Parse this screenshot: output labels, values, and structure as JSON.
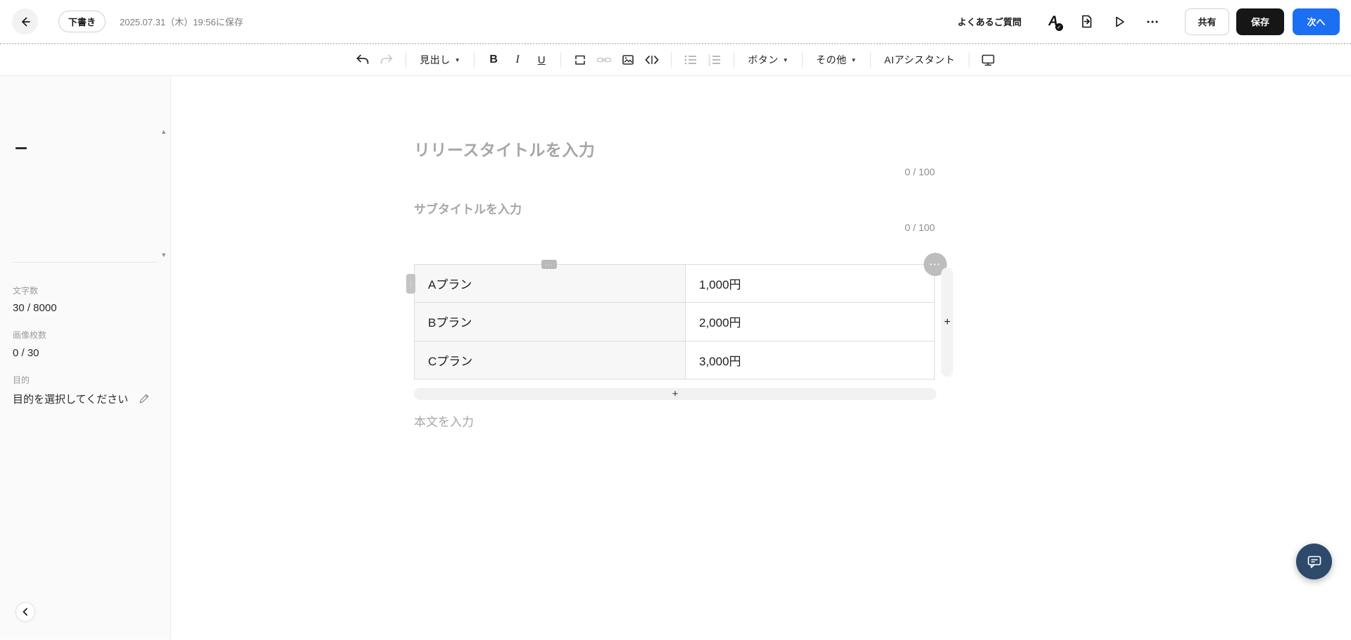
{
  "header": {
    "status_badge": "下書き",
    "saved_at": "2025.07.31（木）19:56に保存",
    "faq_link": "よくあるご質問",
    "proofread_glyph": "A",
    "share_button": "共有",
    "save_button": "保存",
    "next_button": "次へ"
  },
  "toolbar": {
    "heading_dropdown": "見出し",
    "bold": "B",
    "italic": "I",
    "underline": "U",
    "button_dropdown": "ボタン",
    "others_dropdown": "その他",
    "ai_assistant": "AIアシスタント"
  },
  "sidebar": {
    "stats": [
      {
        "label": "文字数",
        "value": "30 / 8000"
      },
      {
        "label": "画像枚数",
        "value": "0 / 30"
      },
      {
        "label": "目的",
        "value": "目的を選択してください"
      }
    ]
  },
  "editor": {
    "title_placeholder": "リリースタイトルを入力",
    "title_counter": "0 / 100",
    "subtitle_placeholder": "サブタイトルを入力",
    "subtitle_counter": "0 / 100",
    "body_placeholder": "本文を入力",
    "table": {
      "rows": [
        {
          "plan": "Aプラン",
          "price": "1,000円"
        },
        {
          "plan": "Bプラン",
          "price": "2,000円"
        },
        {
          "plan": "Cプラン",
          "price": "3,000円"
        }
      ]
    }
  },
  "glyphs": {
    "more_dots": "···",
    "vertical_dots": "⋮",
    "plus": "+",
    "caret_down": "▼",
    "scroll_up": "▲",
    "scroll_down": "▼",
    "check": "✓"
  },
  "colors": {
    "accent_blue": "#1c6ef3",
    "save_black": "#161616",
    "chat_navy": "#2d4a6b",
    "placeholder_gray": "#a6a6a6",
    "table_header_bg": "#f7f7f7"
  }
}
